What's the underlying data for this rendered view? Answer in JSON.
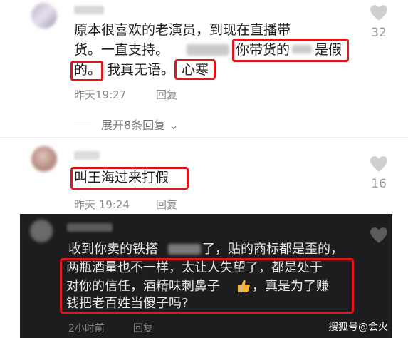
{
  "comments": [
    {
      "lines": [
        "原本很喜欢的老演员，到现在直播带",
        "货。一直支持。",
        "你带货的",
        "是假",
        "的。",
        "我真无语。",
        "心寒"
      ],
      "time": "昨天19:27",
      "reply": "回复",
      "likes": "32"
    },
    {
      "lines": [
        "叫王海过来打假"
      ],
      "time": "昨天 19:24",
      "reply": "回复",
      "likes": "16"
    },
    {
      "lines": [
        "收到你卖的铁搭",
        "了，贴的商标都是歪的，",
        "两瓶酒量也不一样，太让人失望了，都是处于",
        "对你的信任，酒精味刺鼻子",
        "，真是为了赚",
        "钱把老百姓当傻子吗?"
      ],
      "time": "2小时前",
      "reply": "回复"
    }
  ],
  "expand_replies": "展开8条回复",
  "watermark": "搜狐号@会火",
  "colors": {
    "highlight": "#e0161c",
    "dark_bg": "#1d1d1f"
  }
}
